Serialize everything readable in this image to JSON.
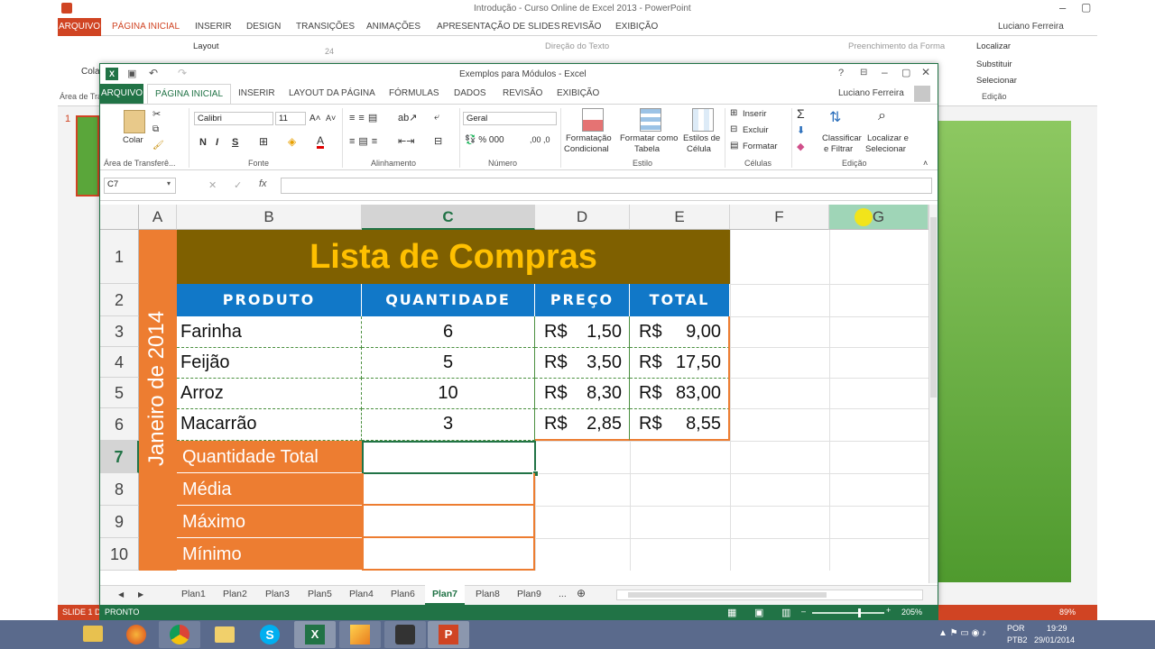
{
  "powerpoint": {
    "title": "Introdução - Curso Online de Excel 2013 - PowerPoint",
    "user": "Luciano Ferreira",
    "tabs": [
      "ARQUIVO",
      "PÁGINA INICIAL",
      "INSERIR",
      "DESIGN",
      "TRANSIÇÕES",
      "ANIMAÇÕES",
      "APRESENTAÇÃO DE SLIDES",
      "REVISÃO",
      "EXIBIÇÃO"
    ],
    "ribbon": {
      "layout": "Layout",
      "font_size": "24",
      "text_direction": "Direção do Texto",
      "shape_fill": "Preenchimento da Forma",
      "find": "Localizar",
      "replace": "Substituir",
      "select": "Selecionar",
      "editing": "Edição",
      "paste": "Cola",
      "clipboard": "Área de Tra"
    },
    "slide_number": "1",
    "status_slide": "SLIDE 1 D",
    "zoom": "89%",
    "slide_color": "#5aa63a"
  },
  "excel": {
    "title": "Exemplos para Módulos - Excel",
    "user": "Luciano Ferreira",
    "tabs": [
      "ARQUIVO",
      "PÁGINA INICIAL",
      "INSERIR",
      "LAYOUT DA PÁGINA",
      "FÓRMULAS",
      "DADOS",
      "REVISÃO",
      "EXIBIÇÃO"
    ],
    "ribbon": {
      "paste": "Colar",
      "clipboard": "Área de Transferê...",
      "font_name": "Calibri",
      "font_size": "11",
      "font_group": "Fonte",
      "align_group": "Alinhamento",
      "number_format": "Geral",
      "number_group": "Número",
      "cond_format": "Formatação",
      "cond_format2": "Condicional",
      "format_table": "Formatar como",
      "format_table2": "Tabela",
      "cell_styles": "Estilos de",
      "cell_styles2": "Célula",
      "styles_group": "Estilo",
      "insert": "Inserir",
      "delete": "Excluir",
      "format": "Formatar",
      "cells_group": "Células",
      "sort": "Classificar",
      "sort2": "e Filtrar",
      "find": "Localizar e",
      "find2": "Selecionar",
      "editing_group": "Edição",
      "bold": "N",
      "italic": "I",
      "underline": "S"
    },
    "name_box": "C7",
    "formula": "",
    "accent": "#217346",
    "columns": [
      "A",
      "B",
      "C",
      "D",
      "E",
      "F",
      "G"
    ],
    "rows": [
      "1",
      "2",
      "3",
      "4",
      "5",
      "6",
      "7",
      "8",
      "9",
      "10"
    ],
    "sheet": {
      "title": "Lista de Compras",
      "side_label": "Janeiro de 2014",
      "headers": [
        "Produto",
        "Quantidade",
        "Preço",
        "Total"
      ],
      "items": [
        {
          "produto": "Farinha",
          "qtd": "6",
          "preco": "1,50",
          "total": "9,00"
        },
        {
          "produto": "Feijão",
          "qtd": "5",
          "preco": "3,50",
          "total": "17,50"
        },
        {
          "produto": "Arroz",
          "qtd": "10",
          "preco": "8,30",
          "total": "83,00"
        },
        {
          "produto": "Macarrão",
          "qtd": "3",
          "preco": "2,85",
          "total": "8,55"
        }
      ],
      "currency": "R$",
      "summary": [
        "Quantidade Total",
        "Média",
        "Máximo",
        "Mínimo"
      ],
      "title_bg": "#7f6000",
      "title_color": "#ffc000",
      "header_bg": "#1178c8",
      "label_bg": "#ed7d31"
    },
    "sheet_tabs": [
      "Plan1",
      "Plan2",
      "Plan3",
      "Plan5",
      "Plan4",
      "Plan6",
      "Plan7",
      "Plan8",
      "Plan9"
    ],
    "active_sheet": "Plan7",
    "more_sheets": "...",
    "status": "PRONTO",
    "zoom": "205%"
  },
  "taskbar": {
    "lang": "POR",
    "layout": "PTB2",
    "time": "19:29",
    "date": "29/01/2014",
    "apps": [
      "explorer-icon",
      "firefox-icon",
      "chrome-icon",
      "folder-icon",
      "skype-icon",
      "excel-icon",
      "pen-icon",
      "presenter-icon",
      "powerpoint-icon"
    ]
  }
}
